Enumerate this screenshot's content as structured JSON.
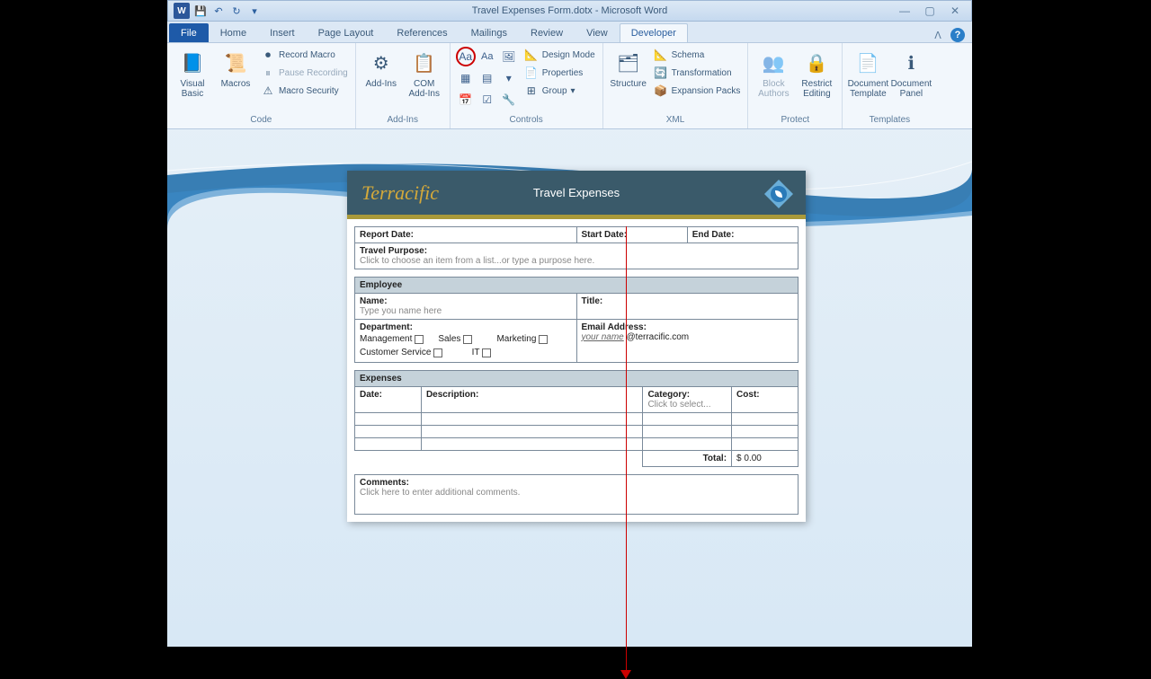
{
  "window": {
    "title": "Travel Expenses Form.dotx  -  Microsoft Word"
  },
  "tabs": {
    "file": "File",
    "home": "Home",
    "insert": "Insert",
    "pageLayout": "Page Layout",
    "references": "References",
    "mailings": "Mailings",
    "review": "Review",
    "view": "View",
    "developer": "Developer"
  },
  "ribbon": {
    "code": {
      "label": "Code",
      "visualBasic": "Visual Basic",
      "macros": "Macros",
      "recordMacro": "Record Macro",
      "pauseRecording": "Pause Recording",
      "macroSecurity": "Macro Security"
    },
    "addins": {
      "label": "Add-Ins",
      "addIns": "Add-Ins",
      "comAddIns": "COM Add-Ins"
    },
    "controls": {
      "label": "Controls",
      "designMode": "Design Mode",
      "properties": "Properties",
      "group": "Group"
    },
    "xml": {
      "label": "XML",
      "structure": "Structure",
      "schema": "Schema",
      "transformation": "Transformation",
      "expansionPacks": "Expansion Packs"
    },
    "protect": {
      "label": "Protect",
      "blockAuthors": "Block Authors",
      "restrictEditing": "Restrict Editing"
    },
    "templates": {
      "label": "Templates",
      "documentTemplate": "Document Template",
      "documentPanel": "Document Panel"
    }
  },
  "doc": {
    "brand": "Terracific",
    "title": "Travel Expenses",
    "reportDate": "Report Date:",
    "startDate": "Start Date:",
    "endDate": "End Date:",
    "travelPurpose": "Travel Purpose:",
    "travelPurposePlaceholder": "Click to choose an item from a list...or type a purpose here.",
    "employee": "Employee",
    "name": "Name:",
    "namePlaceholder": "Type you name here",
    "titleField": "Title:",
    "department": "Department:",
    "emailAddress": "Email Address:",
    "emailPlaceholder": "your name",
    "emailDomain": " @terracific.com",
    "depts": {
      "management": "Management",
      "sales": "Sales",
      "marketing": "Marketing",
      "customerService": "Customer Service",
      "it": "IT"
    },
    "expenses": "Expenses",
    "date": "Date:",
    "description": "Description:",
    "category": "Category:",
    "categoryPlaceholder": "Click to select...",
    "cost": "Cost:",
    "total": "Total:",
    "totalValue": "$   0.00",
    "comments": "Comments:",
    "commentsPlaceholder": "Click here to enter additional comments."
  }
}
